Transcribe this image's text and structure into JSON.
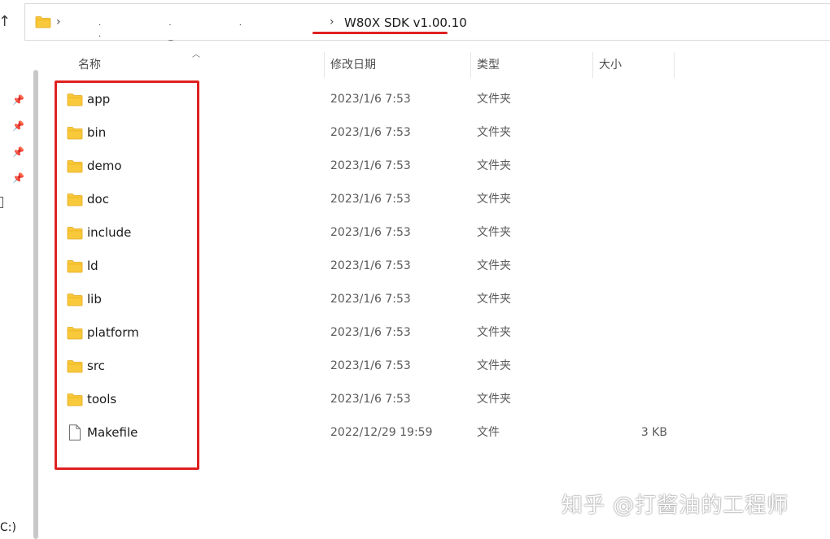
{
  "address_bar": {
    "hidden_path": "·  ·  ·  ·  _",
    "current_folder": "W80X SDK v1.00.10"
  },
  "columns": {
    "name": "名称",
    "date_modified": "修改日期",
    "type": "类型",
    "size": "大小"
  },
  "files": [
    {
      "name": "app",
      "date": "2023/1/6 7:53",
      "type": "文件夹",
      "size": "",
      "icon": "folder-icon"
    },
    {
      "name": "bin",
      "date": "2023/1/6 7:53",
      "type": "文件夹",
      "size": "",
      "icon": "folder-icon"
    },
    {
      "name": "demo",
      "date": "2023/1/6 7:53",
      "type": "文件夹",
      "size": "",
      "icon": "folder-icon"
    },
    {
      "name": "doc",
      "date": "2023/1/6 7:53",
      "type": "文件夹",
      "size": "",
      "icon": "folder-icon"
    },
    {
      "name": "include",
      "date": "2023/1/6 7:53",
      "type": "文件夹",
      "size": "",
      "icon": "folder-icon"
    },
    {
      "name": "ld",
      "date": "2023/1/6 7:53",
      "type": "文件夹",
      "size": "",
      "icon": "folder-icon"
    },
    {
      "name": "lib",
      "date": "2023/1/6 7:53",
      "type": "文件夹",
      "size": "",
      "icon": "folder-icon"
    },
    {
      "name": "platform",
      "date": "2023/1/6 7:53",
      "type": "文件夹",
      "size": "",
      "icon": "folder-icon"
    },
    {
      "name": "src",
      "date": "2023/1/6 7:53",
      "type": "文件夹",
      "size": "",
      "icon": "folder-icon"
    },
    {
      "name": "tools",
      "date": "2023/1/6 7:53",
      "type": "文件夹",
      "size": "",
      "icon": "folder-icon"
    },
    {
      "name": "Makefile",
      "date": "2022/12/29 19:59",
      "type": "文件",
      "size": "3 KB",
      "icon": "file-icon"
    }
  ],
  "left_pane": {
    "drive_label": "C:)"
  },
  "watermark": "知乎 @打酱油的工程师",
  "colors": {
    "highlight": "#e02020",
    "folder_yellow": "#f8c93a",
    "folder_dark": "#e3a91f"
  }
}
